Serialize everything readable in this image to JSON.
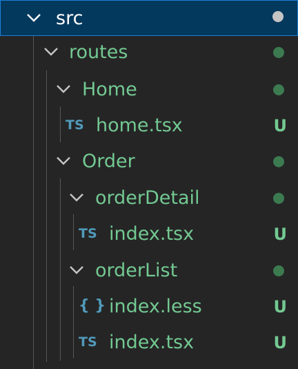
{
  "colors": {
    "background": "#252526",
    "selection": "#04395e",
    "selection_border": "#1b80d6",
    "untracked_text": "#73c991",
    "folder_dot": "#3c7a50",
    "selected_text": "#ffffff",
    "selected_dot": "#c5c5c5",
    "ts_icon": "#519aba",
    "json_icon": "#519aba",
    "guide": "#585858"
  },
  "tree": {
    "src": {
      "label": "src",
      "icon": "chevron-down-icon",
      "selected": true
    },
    "routes": {
      "label": "routes",
      "icon": "chevron-down-icon"
    },
    "home_folder": {
      "label": "Home",
      "icon": "chevron-down-icon"
    },
    "home_file": {
      "label": "home.tsx",
      "file_icon": "TS",
      "status": "U"
    },
    "order_folder": {
      "label": "Order",
      "icon": "chevron-down-icon"
    },
    "order_detail_folder": {
      "label": "orderDetail",
      "icon": "chevron-down-icon"
    },
    "order_detail_index": {
      "label": "index.tsx",
      "file_icon": "TS",
      "status": "U"
    },
    "order_list_folder": {
      "label": "orderList",
      "icon": "chevron-down-icon"
    },
    "order_list_less": {
      "label": "index.less",
      "file_icon": "{ }",
      "status": "U"
    },
    "order_list_index": {
      "label": "index.tsx",
      "file_icon": "TS",
      "status": "U"
    }
  }
}
